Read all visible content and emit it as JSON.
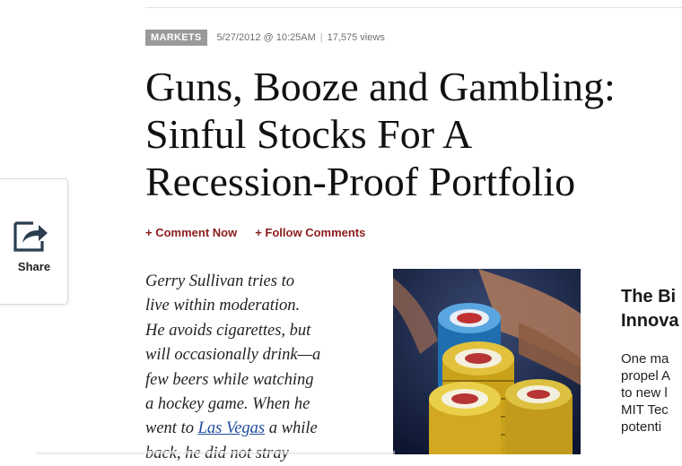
{
  "article": {
    "category": "MARKETS",
    "timestamp": "5/27/2012 @ 10:25AM",
    "views": "17,575 views",
    "headline": [
      "Guns, Booze and Gambling:",
      "Sinful Stocks For A",
      "Recession-Proof Portfolio"
    ],
    "actions": {
      "comment": "+ Comment Now",
      "follow": "+ Follow Comments"
    },
    "body": {
      "line1": "Gerry Sullivan tries to",
      "line2": "live within moderation.",
      "line3": "He avoids cigarettes, but",
      "line4": "will occasionally drink—a",
      "line5": "few beers while watching",
      "line6": "a hockey game. When he",
      "line7_before": "went to ",
      "line7_link": "Las Vegas",
      "line7_after": " a while",
      "line8": "back, he did not stray"
    }
  },
  "share": {
    "label": "Share",
    "icon": "share-arrow-icon"
  },
  "sidebar": {
    "title": [
      "The Bi",
      "Innova"
    ],
    "body": [
      "One ma",
      "propel A",
      "to new l",
      "MIT Tec",
      "potenti"
    ]
  },
  "colors": {
    "accent": "#8b1c1c",
    "badge": "#9a9a9a",
    "link": "#1f4c9e"
  }
}
